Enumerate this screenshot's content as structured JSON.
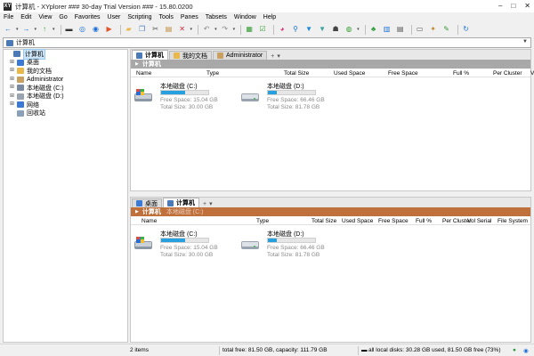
{
  "window": {
    "title": "计算机 - XYplorer ### 30-day Trial Version ### - 15.80.0200",
    "app_icon": "XY",
    "minimize": "–",
    "maximize": "□",
    "close": "✕"
  },
  "menu": [
    "File",
    "Edit",
    "View",
    "Go",
    "Favorites",
    "User",
    "Scripting",
    "Tools",
    "Panes",
    "Tabsets",
    "Window",
    "Help"
  ],
  "toolbar": {
    "icons": [
      {
        "name": "back-icon",
        "glyph": "←",
        "color": "#1a6fd6"
      },
      {
        "name": "forward-icon",
        "glyph": "→",
        "color": "#1a6fd6"
      },
      {
        "name": "up-icon",
        "glyph": "↑",
        "color": "#29a33a"
      },
      {
        "name": "monitor-icon",
        "glyph": "▬",
        "color": "#333333"
      },
      {
        "name": "target-icon",
        "glyph": "◎",
        "color": "#1a6fd6"
      },
      {
        "name": "zoom-icon",
        "glyph": "◉",
        "color": "#1a6fd6"
      },
      {
        "name": "play-icon",
        "glyph": "▶",
        "color": "#e0542a"
      },
      {
        "name": "folder-icon",
        "glyph": "▰",
        "color": "#e8b84a"
      },
      {
        "name": "copy-icon",
        "glyph": "❐",
        "color": "#4a7ab8"
      },
      {
        "name": "cut-icon",
        "glyph": "✂",
        "color": "#555555"
      },
      {
        "name": "paste-icon",
        "glyph": "▤",
        "color": "#c08a3a"
      },
      {
        "name": "delete-icon",
        "glyph": "✕",
        "color": "#d8283a"
      },
      {
        "name": "undo-icon",
        "glyph": "↶",
        "color": "#888888"
      },
      {
        "name": "redo-icon",
        "glyph": "↷",
        "color": "#888888"
      },
      {
        "name": "select-icon",
        "glyph": "▦",
        "color": "#3aa03a"
      },
      {
        "name": "checkbox-icon",
        "glyph": "☑",
        "color": "#3aa03a"
      },
      {
        "name": "pie-icon",
        "glyph": "◕",
        "color": "#d83a7a"
      },
      {
        "name": "search-icon",
        "glyph": "⚲",
        "color": "#1a6fd6"
      },
      {
        "name": "filter-icon",
        "glyph": "▼",
        "color": "#1a8ad6"
      },
      {
        "name": "filter-color-icon",
        "glyph": "▼",
        "color": "#3aa0a0"
      },
      {
        "name": "ghost-icon",
        "glyph": "☗",
        "color": "#444444"
      },
      {
        "name": "funnel-icon",
        "glyph": "◍",
        "color": "#3aa03a"
      },
      {
        "name": "tree-icon",
        "glyph": "♣",
        "color": "#2a9a3a"
      },
      {
        "name": "layout-icon",
        "glyph": "▥",
        "color": "#1a6fd6"
      },
      {
        "name": "panes-icon",
        "glyph": "▤",
        "color": "#555555"
      },
      {
        "name": "dual-pane-icon",
        "glyph": "▭",
        "color": "#555555"
      },
      {
        "name": "tools-icon",
        "glyph": "✦",
        "color": "#c08a3a"
      },
      {
        "name": "brush-icon",
        "glyph": "✎",
        "color": "#3a9a3a"
      },
      {
        "name": "sync-icon",
        "glyph": "↻",
        "color": "#1a6fd6"
      }
    ]
  },
  "address": {
    "value": "计算机",
    "dropdown": "▼"
  },
  "tree": {
    "items": [
      {
        "label": "计算机",
        "expander": "",
        "icon_color": "#4a7ab8",
        "selected": true,
        "indent": 0
      },
      {
        "label": "桌面",
        "expander": "⊞",
        "icon_color": "#3a7ad6",
        "selected": false,
        "indent": 1
      },
      {
        "label": "我的文档",
        "expander": "⊞",
        "icon_color": "#e8b84a",
        "selected": false,
        "indent": 1
      },
      {
        "label": "Administrator",
        "expander": "⊞",
        "icon_color": "#c8a060",
        "selected": false,
        "indent": 1
      },
      {
        "label": "本地磁盘 (C:)",
        "expander": "⊞",
        "icon_color": "#7a8aa0",
        "selected": false,
        "indent": 1
      },
      {
        "label": "本地磁盘 (D:)",
        "expander": "⊞",
        "icon_color": "#9aa4b0",
        "selected": false,
        "indent": 1
      },
      {
        "label": "网络",
        "expander": "⊞",
        "icon_color": "#3a7ad6",
        "selected": false,
        "indent": 1
      },
      {
        "label": "回收站",
        "expander": "",
        "icon_color": "#8aa0b8",
        "selected": false,
        "indent": 1
      }
    ]
  },
  "pane1": {
    "tabs": [
      {
        "label": "计算机",
        "active": true,
        "icon_color": "#4a7ab8"
      },
      {
        "label": "我的文档",
        "active": false,
        "icon_color": "#e8b84a"
      },
      {
        "label": "Administrator",
        "active": false,
        "icon_color": "#c8a060"
      }
    ],
    "tab_add": "+",
    "tab_menu": "▾",
    "breadcrumb": {
      "label": "计算机",
      "arrow": "▶",
      "sub": ""
    },
    "header_color": "#a8a8a8",
    "columns": [
      "Name",
      "Type",
      "Total Size",
      "Used Space",
      "Free Space",
      "Full %",
      "Per Cluster",
      "Vol"
    ],
    "drives": [
      {
        "name": "本地磁盘 (C:)",
        "free": "Free Space: 15.04 GB",
        "total": "Total Size: 30.00 GB",
        "fill": 0.5
      },
      {
        "name": "本地磁盘 (D:)",
        "free": "Free Space: 66.46 GB",
        "total": "Total Size: 81.78 GB",
        "fill": 0.19
      }
    ]
  },
  "pane2": {
    "tabs": [
      {
        "label": "桌面",
        "active": false,
        "icon_color": "#3a7ad6"
      },
      {
        "label": "计算机",
        "active": true,
        "icon_color": "#4a7ab8"
      }
    ],
    "tab_add": "+",
    "tab_menu": "▾",
    "breadcrumb": {
      "label": "计算机",
      "arrow": "▶",
      "sub": "本地磁盘 (C:)"
    },
    "header_color": "#c0703a",
    "columns": [
      "Name",
      "Type",
      "Total Size",
      "Used Space",
      "Free Space",
      "Full %",
      "Per Cluster",
      "Vol Serial",
      "File System"
    ],
    "drives": [
      {
        "name": "本地磁盘 (C:)",
        "free": "Free Space: 15.04 GB",
        "total": "Total Size: 30.00 GB",
        "fill": 0.5
      },
      {
        "name": "本地磁盘 (D:)",
        "free": "Free Space: 66.46 GB",
        "total": "Total Size: 81.78 GB",
        "fill": 0.19
      }
    ]
  },
  "status": {
    "items": "2 items",
    "total": "total free: 81.50 GB, capacity: 111.79 GB",
    "disks": "all local disks: 30.28 GB used, 81.50 GB free (73%)"
  }
}
